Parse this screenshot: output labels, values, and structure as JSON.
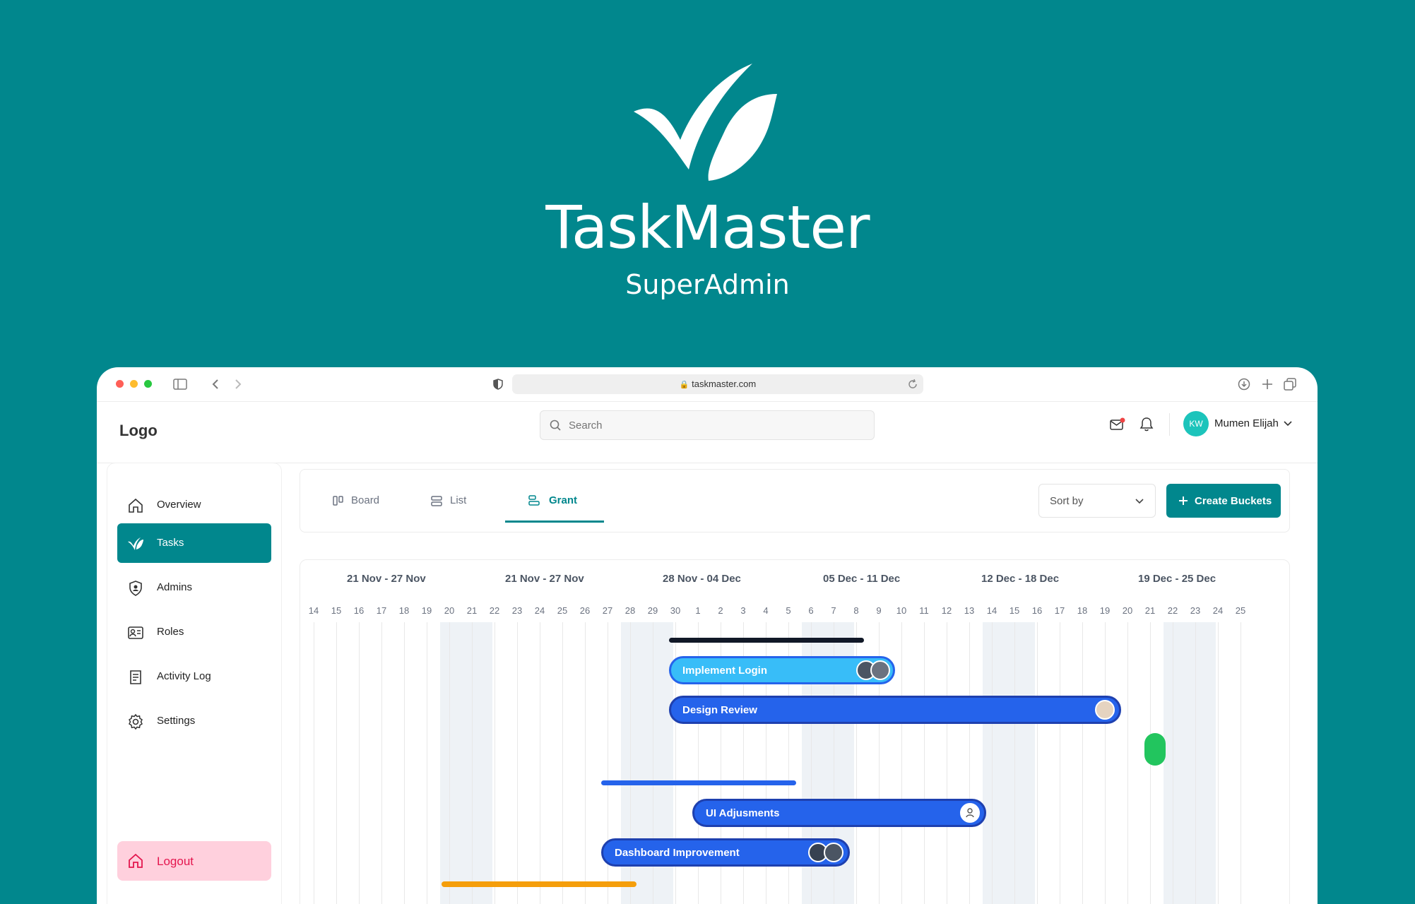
{
  "hero": {
    "title": "TaskMaster",
    "subtitle": "SuperAdmin"
  },
  "browser": {
    "url": "taskmaster.com"
  },
  "header": {
    "logo": "Logo",
    "search_placeholder": "Search",
    "user_initials": "KW",
    "user_name": "Mumen Elijah"
  },
  "sidebar": {
    "items": [
      {
        "label": "Overview"
      },
      {
        "label": "Tasks"
      },
      {
        "label": "Admins"
      },
      {
        "label": "Roles"
      },
      {
        "label": "Activity Log"
      },
      {
        "label": "Settings"
      }
    ],
    "logout": "Logout"
  },
  "tabs": [
    {
      "label": "Board"
    },
    {
      "label": "List"
    },
    {
      "label": "Grant"
    }
  ],
  "toolbar": {
    "sort_label": "Sort by",
    "create_label": "Create Buckets"
  },
  "gantt": {
    "weeks": [
      "21 Nov - 27 Nov",
      "21 Nov - 27 Nov",
      "28 Nov - 04 Dec",
      "05 Dec - 11 Dec",
      "12 Dec - 18 Dec",
      "19 Dec - 25 Dec"
    ],
    "days": [
      "14",
      "15",
      "16",
      "17",
      "18",
      "19",
      "20",
      "21",
      "22",
      "23",
      "24",
      "25",
      "26",
      "27",
      "28",
      "29",
      "30",
      "1",
      "2",
      "3",
      "4",
      "5",
      "6",
      "7",
      "8",
      "9",
      "10",
      "11",
      "12",
      "13",
      "14",
      "15",
      "16",
      "17",
      "18",
      "19",
      "20",
      "21",
      "22",
      "23",
      "24",
      "25"
    ],
    "tasks": [
      {
        "label": "Implement Login",
        "color": "#38bdf8"
      },
      {
        "label": "Design Review",
        "color": "#2563eb"
      },
      {
        "label": "UI Adjusments",
        "color": "#2563eb"
      },
      {
        "label": "Dashboard Improvement",
        "color": "#2563eb"
      }
    ],
    "colors": {
      "accent": "#01878d",
      "dark": "#111827",
      "blue": "#2563eb",
      "green": "#22c55e",
      "orange": "#f59e0b"
    }
  }
}
